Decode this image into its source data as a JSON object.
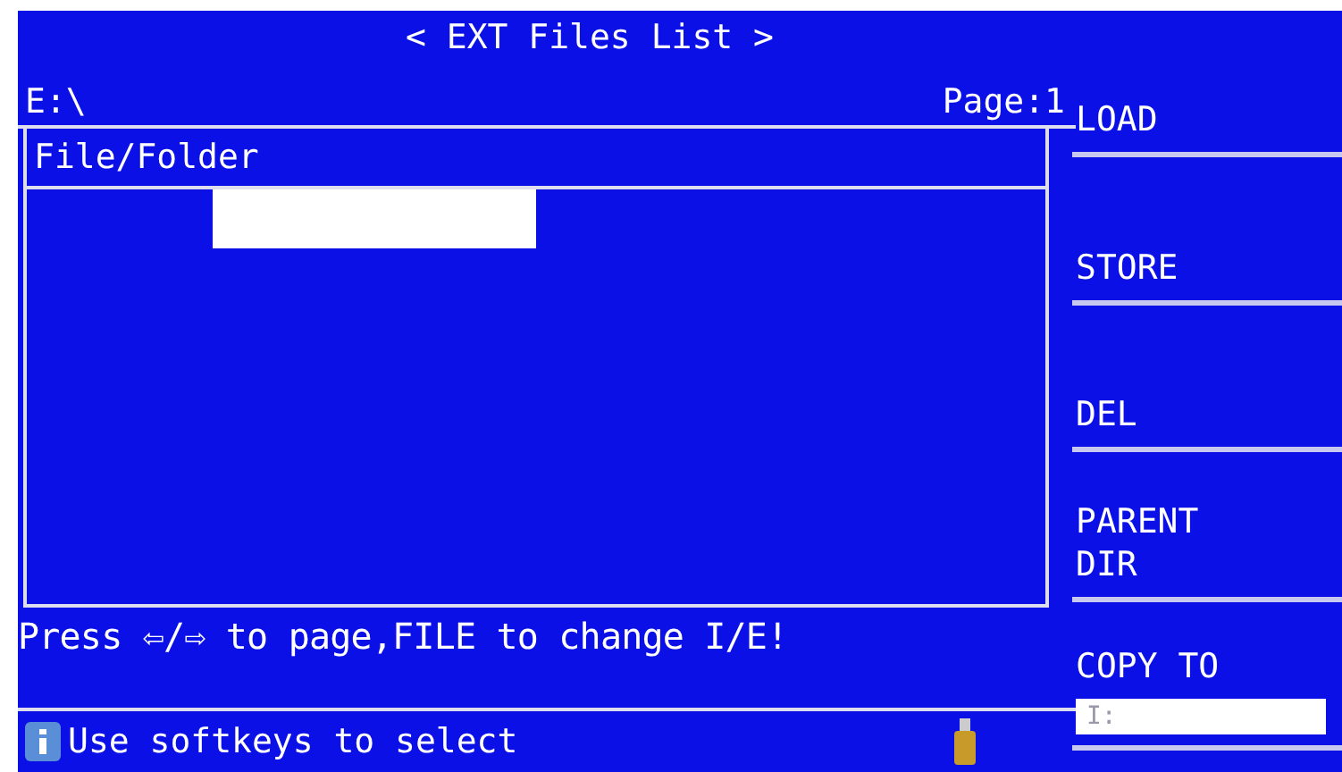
{
  "title": "< EXT Files List >",
  "path": "E:\\",
  "page": "Page:1",
  "table": {
    "columns": [
      "File/Folder"
    ],
    "rows": [
      {
        "selected": true
      }
    ]
  },
  "hint": "Press ⇦/⇨ to page,FILE to change I/E!",
  "status": "Use softkeys to select",
  "softkeys": [
    {
      "kind": "key",
      "label": "LOAD"
    },
    {
      "kind": "key",
      "label": "STORE"
    },
    {
      "kind": "key",
      "label": "DEL"
    },
    {
      "kind": "key",
      "label": "PARENT DIR"
    },
    {
      "kind": "field",
      "label": "COPY TO",
      "value": "I:"
    }
  ]
}
